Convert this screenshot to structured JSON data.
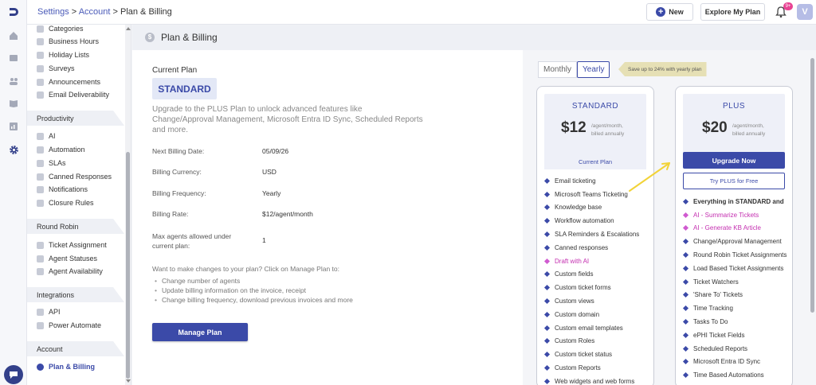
{
  "topbar": {
    "breadcrumb": {
      "settings": "Settings",
      "sep1": " > ",
      "account": "Account",
      "sep2": " > ",
      "current": "Plan & Billing"
    },
    "new_label": "New",
    "explore_label": "Explore My Plan",
    "notif_badge": "9+",
    "avatar_letter": "V"
  },
  "sidebar": {
    "general_items": [
      "Categories",
      "Business Hours",
      "Holiday Lists",
      "Surveys",
      "Announcements",
      "Email Deliverability"
    ],
    "productivity_header": "Productivity",
    "productivity_items": [
      "AI",
      "Automation",
      "SLAs",
      "Canned Responses",
      "Notifications",
      "Closure Rules"
    ],
    "round_robin_header": "Round Robin",
    "round_robin_items": [
      "Ticket Assignment",
      "Agent Statuses",
      "Agent Availability"
    ],
    "integrations_header": "Integrations",
    "integrations_items": [
      "API",
      "Power Automate"
    ],
    "account_header": "Account",
    "account_items": [
      "Plan & Billing"
    ]
  },
  "page": {
    "title": "Plan & Billing",
    "title_icon": "$"
  },
  "current_plan": {
    "label": "Current Plan",
    "name": "STANDARD",
    "upgrade_text": "Upgrade to the PLUS Plan to unlock advanced features like Change/Approval Management, Microsoft Entra ID Sync, Scheduled Reports and more.",
    "rows": [
      {
        "label": "Next Billing Date:",
        "value": "05/09/26"
      },
      {
        "label": "Billing Currency:",
        "value": "USD"
      },
      {
        "label": "Billing Frequency:",
        "value": "Yearly"
      },
      {
        "label": "Billing Rate:",
        "value": "$12/agent/month"
      },
      {
        "label": "Max agents allowed under current plan:",
        "value": "1"
      }
    ],
    "change_intro": "Want to make changes to your plan? Click on Manage Plan to:",
    "change_items": [
      "Change number of agents",
      "Update billing information on the invoice, receipt",
      "Change billing frequency, download previous invoices and more"
    ],
    "manage_label": "Manage Plan"
  },
  "billing_toggle": {
    "monthly": "Monthly",
    "yearly": "Yearly",
    "selected": "Yearly",
    "save_tag": "Save up to 24% with yearly plan"
  },
  "plans": {
    "standard": {
      "name": "STANDARD",
      "price": "$12",
      "per": "/agent/month, billed annually",
      "button": "Current Plan",
      "features": [
        {
          "text": "Email ticketing",
          "ai": false
        },
        {
          "text": "Microsoft Teams Ticketing",
          "ai": false
        },
        {
          "text": "Knowledge base",
          "ai": false
        },
        {
          "text": "Workflow automation",
          "ai": false
        },
        {
          "text": "SLA Reminders & Escalations",
          "ai": false
        },
        {
          "text": "Canned responses",
          "ai": false
        },
        {
          "text": "Draft with AI",
          "ai": true
        },
        {
          "text": "Custom fields",
          "ai": false
        },
        {
          "text": "Custom ticket forms",
          "ai": false
        },
        {
          "text": "Custom views",
          "ai": false
        },
        {
          "text": "Custom domain",
          "ai": false
        },
        {
          "text": "Custom email templates",
          "ai": false
        },
        {
          "text": "Custom Roles",
          "ai": false
        },
        {
          "text": "Custom ticket status",
          "ai": false
        },
        {
          "text": "Custom Reports",
          "ai": false
        },
        {
          "text": "Web widgets and web forms",
          "ai": false
        }
      ]
    },
    "plus": {
      "name": "PLUS",
      "price": "$20",
      "per": "/agent/month, billed annually",
      "upgrade_button": "Upgrade Now",
      "try_button": "Try PLUS for Free",
      "features": [
        {
          "text": "Everything in STANDARD and",
          "ai": false,
          "bold": true
        },
        {
          "text": "AI - Summarize Tickets",
          "ai": true
        },
        {
          "text": "AI - Generate KB Article",
          "ai": true
        },
        {
          "text": "Change/Approval Management",
          "ai": false
        },
        {
          "text": "Round Robin Ticket Assignments",
          "ai": false
        },
        {
          "text": "Load Based Ticket Assignments",
          "ai": false
        },
        {
          "text": "Ticket Watchers",
          "ai": false
        },
        {
          "text": "'Share To' Tickets",
          "ai": false
        },
        {
          "text": "Time Tracking",
          "ai": false
        },
        {
          "text": "Tasks To Do",
          "ai": false
        },
        {
          "text": "ePHI Ticket Fields",
          "ai": false
        },
        {
          "text": "Scheduled Reports",
          "ai": false
        },
        {
          "text": "Microsoft Entra ID Sync",
          "ai": false
        },
        {
          "text": "Time Based Automations",
          "ai": false
        }
      ]
    }
  },
  "colors": {
    "accent": "#3b4aa8",
    "ai": "#c42fb0",
    "arrow": "#f2d338"
  }
}
